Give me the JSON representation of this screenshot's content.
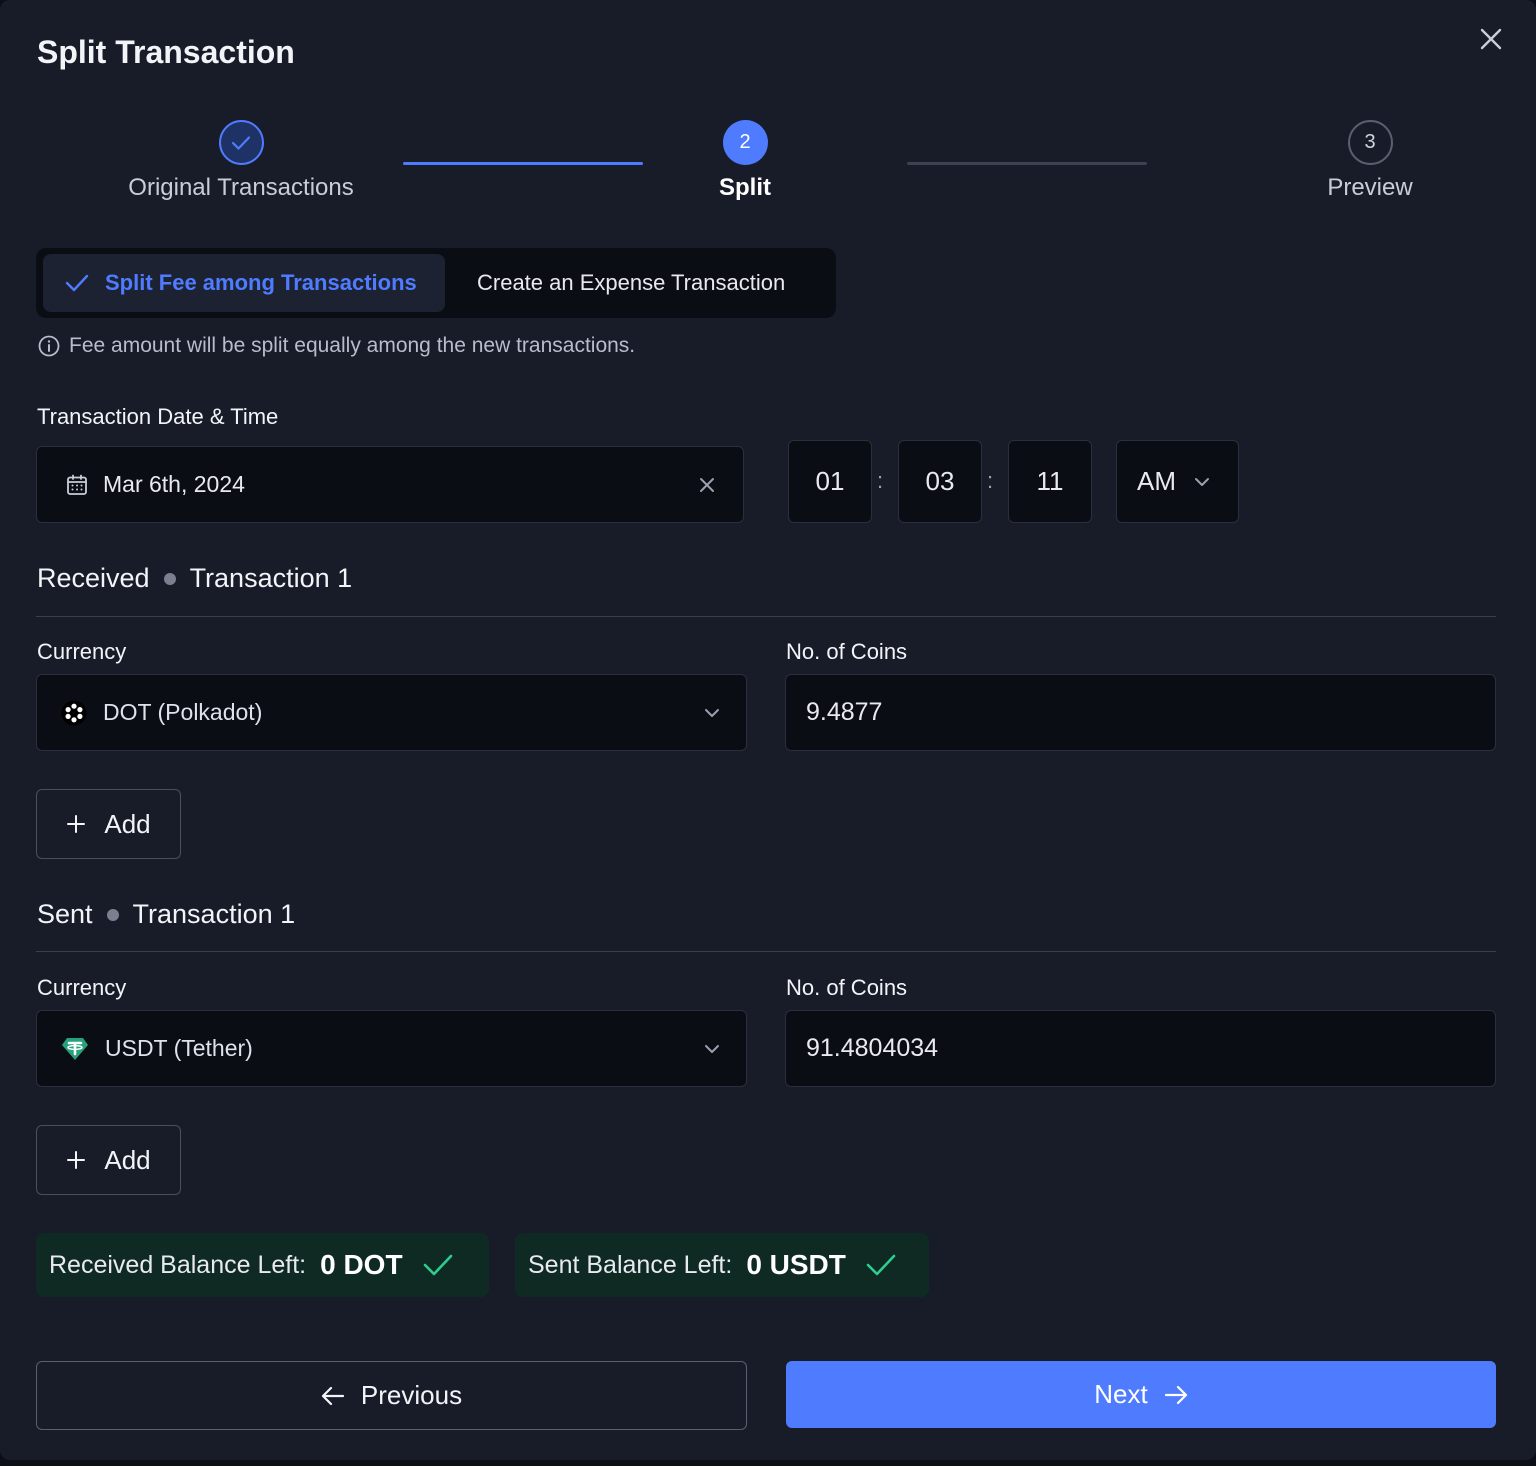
{
  "modal": {
    "title": "Split Transaction"
  },
  "stepper": {
    "steps": [
      {
        "label": "Original Transactions",
        "state": "completed"
      },
      {
        "number": "2",
        "label": "Split",
        "state": "active"
      },
      {
        "number": "3",
        "label": "Preview",
        "state": "upcoming"
      }
    ]
  },
  "fee_toggle": {
    "options": [
      {
        "label": "Split Fee among Transactions",
        "selected": true
      },
      {
        "label": "Create an Expense Transaction",
        "selected": false
      }
    ],
    "info_text": "Fee amount will be split equally among the new transactions."
  },
  "datetime": {
    "label": "Transaction Date & Time",
    "date": "Mar 6th, 2024",
    "hour": "01",
    "minute": "03",
    "second": "11",
    "colon": ":",
    "meridiem": "AM"
  },
  "received": {
    "type": "Received",
    "title": "Transaction 1",
    "currency_label": "Currency",
    "currency": "DOT (Polkadot)",
    "coins_label": "No. of Coins",
    "coins": "9.4877",
    "add_label": "Add"
  },
  "sent": {
    "type": "Sent",
    "title": "Transaction 1",
    "currency_label": "Currency",
    "currency": "USDT (Tether)",
    "coins_label": "No. of Coins",
    "coins": "91.4804034",
    "add_label": "Add"
  },
  "balances": {
    "received_label": "Received Balance Left:",
    "received_value": "0 DOT",
    "sent_label": "Sent Balance Left:",
    "sent_value": "0 USDT"
  },
  "footer": {
    "previous_label": "Previous",
    "next_label": "Next"
  },
  "colors": {
    "accent": "#4f7cff",
    "success": "#2ecc8f",
    "tether": "#26a17b",
    "background": "#181c28"
  }
}
